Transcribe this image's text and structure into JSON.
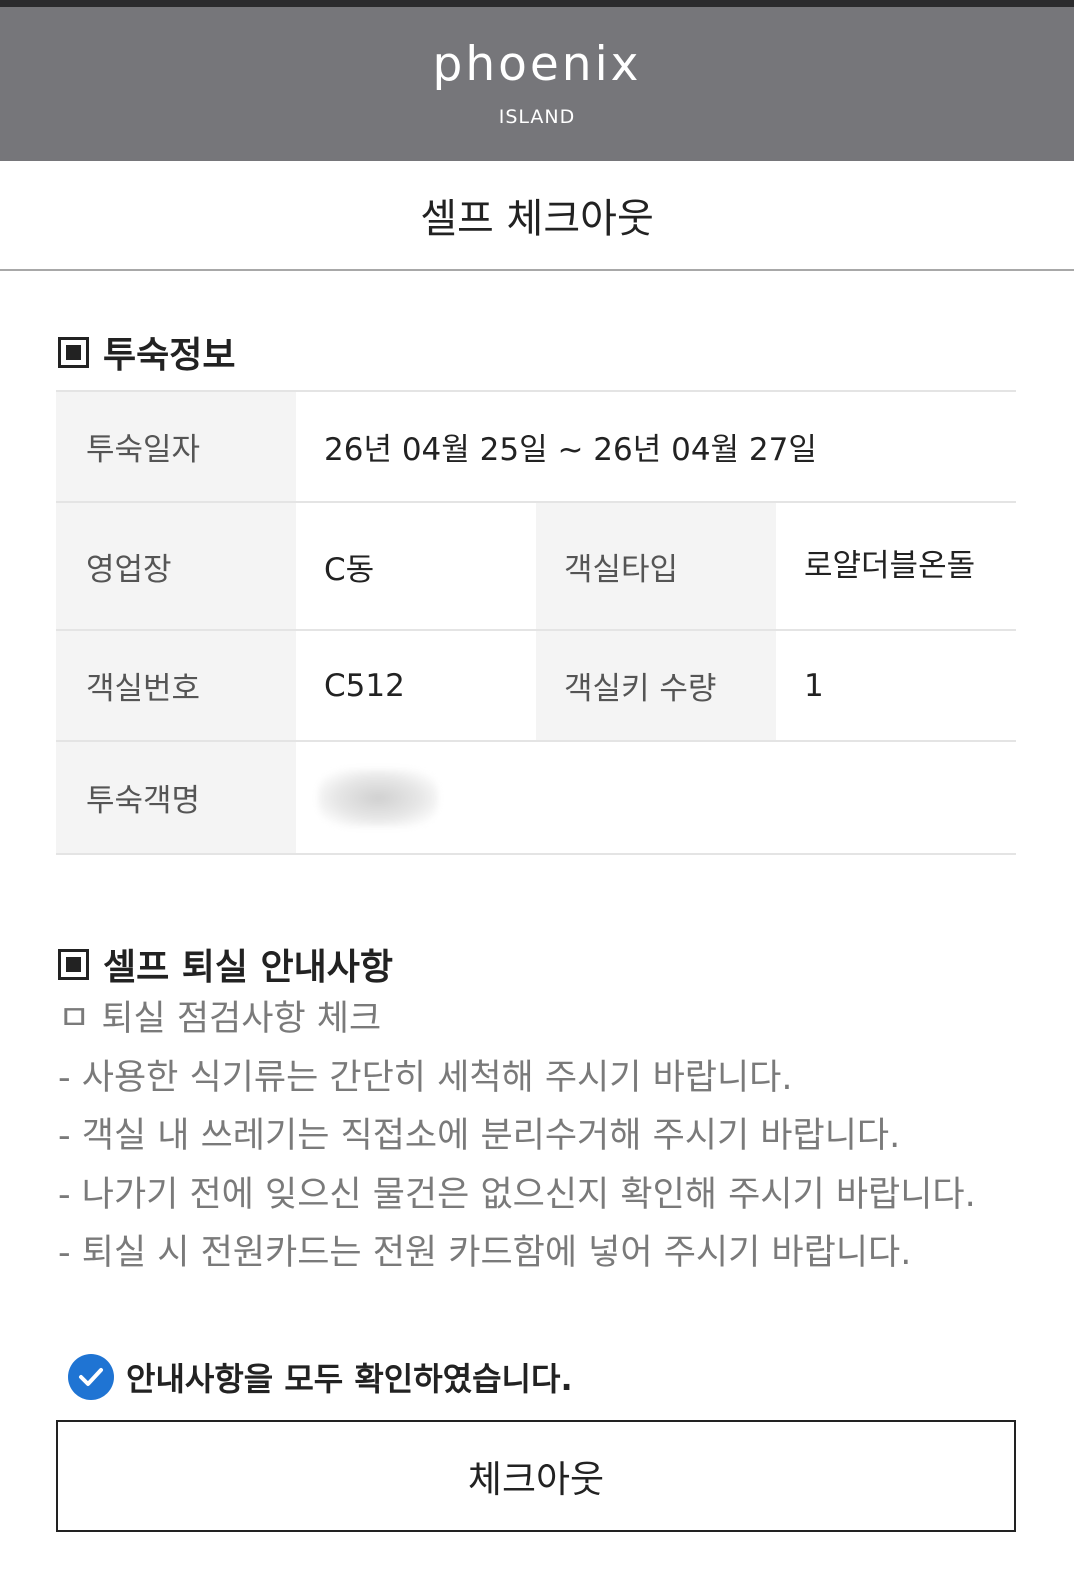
{
  "brand": {
    "logo": "phoenix",
    "sub": "ISLAND"
  },
  "page": {
    "title": "셀프 체크아웃"
  },
  "stay_info": {
    "heading": "투숙정보",
    "rows": {
      "date_label": "투숙일자",
      "date_value": "26년 04월 25일 ~ 26년 04월 27일",
      "site_label": "영업장",
      "site_value": "C동",
      "room_type_label": "객실타입",
      "room_type_value": "로얄더블온돌",
      "room_no_label": "객실번호",
      "room_no_value": "C512",
      "key_qty_label": "객실키 수량",
      "key_qty_value": "1",
      "guest_label": "투숙객명"
    }
  },
  "notice": {
    "heading": "셀프 퇴실 안내사항",
    "subheading": "ㅁ 퇴실 점검사항 체크",
    "items": [
      "- 사용한 식기류는 간단히 세척해 주시기 바랍니다.",
      "- 객실 내 쓰레기는 직접소에 분리수거해 주시기 바랍니다.",
      "- 나가기 전에 잊으신 물건은 없으신지 확인해 주시기 바랍니다.",
      "- 퇴실 시 전원카드는 전원 카드함에 넣어 주시기 바랍니다."
    ],
    "confirm_label": "안내사항을 모두 확인하였습니다."
  },
  "actions": {
    "checkout_label": "체크아웃"
  },
  "colors": {
    "header_bg": "#76767a",
    "check_blue": "#1f74d3",
    "label_bg": "#f4f4f4"
  }
}
